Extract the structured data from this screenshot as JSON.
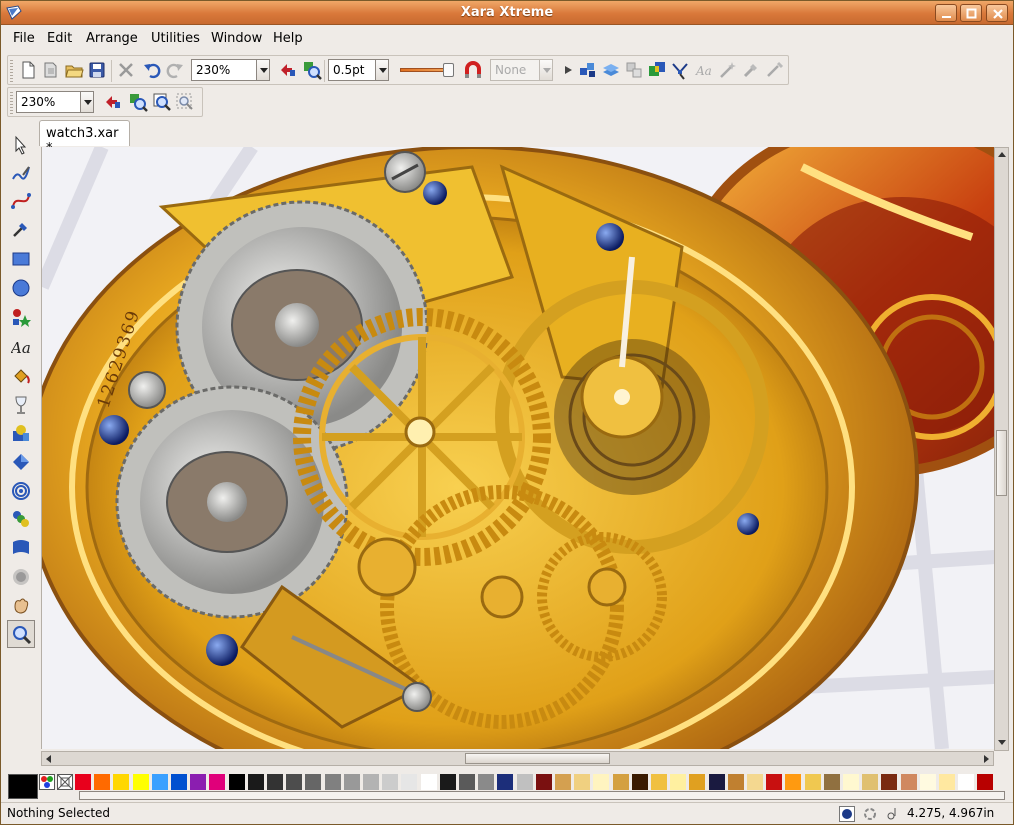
{
  "window": {
    "title": "Xara Xtreme",
    "accent": "#d9783a"
  },
  "menu": [
    {
      "label": "File"
    },
    {
      "label": "Edit"
    },
    {
      "label": "Arrange"
    },
    {
      "label": "Utilities"
    },
    {
      "label": "Window"
    },
    {
      "label": "Help"
    }
  ],
  "toolbar": {
    "zoom_value": "230%",
    "line_width_value": "0.5pt",
    "arrowhead_value": "None",
    "icons": [
      "new-document-icon",
      "open-template-icon",
      "open-file-icon",
      "save-icon",
      "delete-icon",
      "undo-icon",
      "redo-icon"
    ]
  },
  "zoom_bar": {
    "zoom_value": "230%"
  },
  "tools": [
    "selector",
    "freehand-pen",
    "bezier",
    "shape-editor",
    "rectangle",
    "ellipse",
    "quickshape",
    "text",
    "fill",
    "transparency",
    "mould",
    "contour",
    "bevel",
    "blend",
    "feather",
    "shadow",
    "push",
    "zoom"
  ],
  "document": {
    "tab_label": "watch3.xar *",
    "dial_numerals": "12629369"
  },
  "palette": {
    "no_color": "#000000",
    "colors": [
      "#e8001c",
      "#ff6a00",
      "#ffd700",
      "#ffff00",
      "#3aa0ff",
      "#0050d0",
      "#8b1eb0",
      "#e0007a",
      "#000000",
      "#1a1a1a",
      "#333333",
      "#4d4d4d",
      "#666666",
      "#808080",
      "#999999",
      "#b3b3b3",
      "#cccccc",
      "#e6e6e6",
      "#ffffff",
      "#1a1a1a",
      "#5a5a5a",
      "#8a8a8a",
      "#1c2e7a",
      "#c0c0c0",
      "#7a1010",
      "#d4a050",
      "#f0d080",
      "#fff4c0",
      "#d4a040",
      "#3a1a00",
      "#f0c040",
      "#fff0a0",
      "#e0a020",
      "#1a1a40",
      "#c08030",
      "#f4d890",
      "#c81010",
      "#ff9a10",
      "#f0c850",
      "#907040",
      "#fff8d0",
      "#e0c070",
      "#7a2a10",
      "#d08860",
      "#fffae0",
      "#ffe8a0",
      "#ffffff",
      "#b80000"
    ]
  },
  "status": {
    "message": "Nothing Selected",
    "coords": "4.275, 4.967in"
  }
}
